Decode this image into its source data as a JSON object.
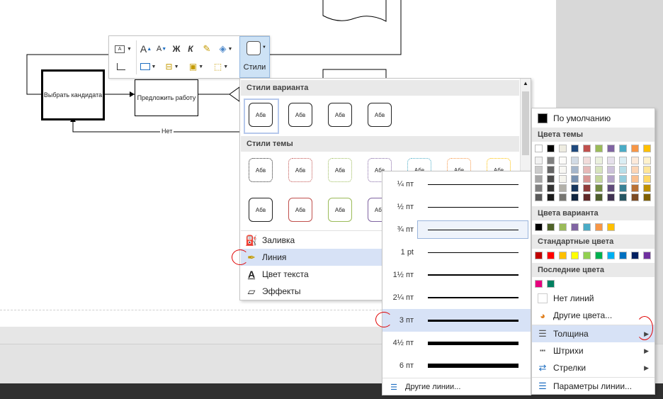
{
  "diagram": {
    "choose_candidate": "Выбрать кандидата",
    "offer_job": "Предложить работу",
    "no_label": "Нет"
  },
  "toolbar": {
    "font_grow": "A",
    "font_shrink": "A",
    "bold": "Ж",
    "italic": "К",
    "styles_label": "Стили"
  },
  "styles_panel": {
    "variant_header": "Стили варианта",
    "theme_header": "Стили темы",
    "swatch_text": "Абв",
    "variant_swatches": [
      {
        "border": "#222222"
      },
      {
        "border": "#222222"
      },
      {
        "border": "#222222"
      },
      {
        "border": "#222222"
      }
    ],
    "theme_row1": [
      {
        "border": "#222222"
      },
      {
        "border": "#c0504d"
      },
      {
        "border": "#9bbb59"
      },
      {
        "border": "#8064a2"
      },
      {
        "border": "#4bacc6"
      },
      {
        "border": "#f79646"
      },
      {
        "border": "#ffc000"
      }
    ],
    "theme_row2": [
      {
        "border": "#222222"
      },
      {
        "border": "#c0504d"
      },
      {
        "border": "#9bbb59"
      },
      {
        "border": "#8064a2"
      }
    ],
    "menu": [
      {
        "label": "Заливка",
        "icon": "fill-bucket-icon"
      },
      {
        "label": "Линия",
        "icon": "line-pen-icon"
      },
      {
        "label": "Цвет текста",
        "icon": "font-color-icon"
      },
      {
        "label": "Эффекты",
        "icon": "effects-icon"
      }
    ]
  },
  "thickness_menu": {
    "items": [
      {
        "label": "¼ пт",
        "weight": 0.25
      },
      {
        "label": "½ пт",
        "weight": 0.5
      },
      {
        "label": "¾ пт",
        "weight": 0.75
      },
      {
        "label": "1 pt",
        "weight": 1
      },
      {
        "label": "1½ пт",
        "weight": 1.5
      },
      {
        "label": "2¼ пт",
        "weight": 2.25
      },
      {
        "label": "3 пт",
        "weight": 3
      },
      {
        "label": "4½ пт",
        "weight": 4.5
      },
      {
        "label": "6 пт",
        "weight": 6
      }
    ],
    "selected": "¾ пт",
    "highlighted": "3 пт",
    "more_lines": "Другие линии..."
  },
  "color_panel": {
    "default": "По умолчанию",
    "theme_header": "Цвета темы",
    "theme_colors": [
      "#ffffff",
      "#000000",
      "#eeece1",
      "#1f497d",
      "#c0504d",
      "#9bbb59",
      "#8064a2",
      "#4bacc6",
      "#f79646",
      "#ffc000"
    ],
    "variant_header": "Цвета варианта",
    "variant_colors": [
      "#000000",
      "#4f6228",
      "#9bbb59",
      "#8064a2",
      "#4bacc6",
      "#f79646",
      "#ffc000"
    ],
    "standard_header": "Стандартные цвета",
    "standard_colors": [
      "#c00000",
      "#ff0000",
      "#ffc000",
      "#ffff00",
      "#92d050",
      "#00b050",
      "#00b0f0",
      "#0070c0",
      "#002060",
      "#7030a0"
    ],
    "recent_header": "Последние цвета",
    "recent_colors": [
      "#e6007e",
      "#008060"
    ],
    "no_lines": "Нет линий",
    "other_colors": "Другие цвета...",
    "thickness": "Толщина",
    "dashes": "Штрихи",
    "arrows": "Стрелки",
    "line_options": "Параметры линии..."
  }
}
